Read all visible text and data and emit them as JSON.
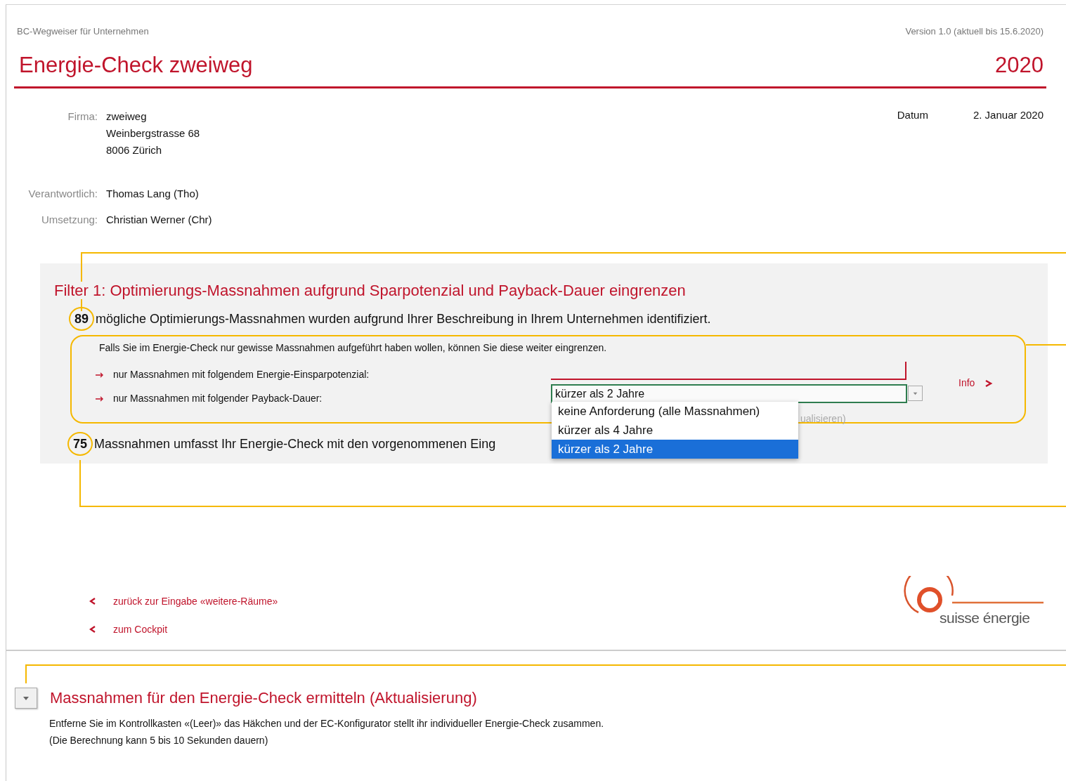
{
  "header": {
    "app_name": "BC-Wegweiser für Unternehmen",
    "version": "Version 1.0 (aktuell bis 15.6.2020)",
    "title": "Energie-Check zweiweg",
    "year": "2020"
  },
  "company": {
    "label": "Firma:",
    "lines": [
      "zweiweg",
      "Weinbergstrasse 68",
      "8006 Zürich"
    ]
  },
  "date": {
    "label": "Datum",
    "value": "2. Januar 2020"
  },
  "people": [
    {
      "label": "Verantwortlich:",
      "value": "Thomas Lang (Tho)"
    },
    {
      "label": "Umsetzung:",
      "value": "Christian Werner (Chr)"
    }
  ],
  "filter": {
    "title": "Filter 1: Optimierungs-Massnahmen aufgrund Sparpotenzial und Payback-Dauer eingrenzen",
    "identified": {
      "count": "89",
      "text": "mögliche Optimierungs-Massnahmen wurden aufgrund Ihrer Beschreibung in Ihrem Unternehmen identifiziert."
    },
    "intro": "Falls Sie im Energie-Check nur gewisse Massnahmen aufgeführt haben wollen, können Sie diese weiter eingrenzen.",
    "criteria": [
      {
        "label": "nur Massnahmen mit folgendem Energie-Einsparpotenzial:"
      },
      {
        "label": "nur Massnahmen mit folgender Payback-Dauer:",
        "value": "kürzer als 2 Jahre",
        "focused": true
      }
    ],
    "info_link": "Info",
    "dropdown": {
      "options": [
        {
          "label": "keine Anforderung (alle Massnahmen)",
          "selected": false
        },
        {
          "label": "kürzer als 4 Jahre",
          "selected": false
        },
        {
          "label": "kürzer als 2 Jahre",
          "selected": true
        }
      ]
    },
    "hint": "ualisieren)",
    "result": {
      "count": "75",
      "text": "Massnahmen umfasst Ihr Energie-Check mit den vorgenommenen Eing"
    }
  },
  "links": [
    "zurück zur Eingabe «weitere-Räume»",
    "zum Cockpit"
  ],
  "logo": {
    "text": "suisse énergie"
  },
  "update_section": {
    "title": "Massnahmen für den Energie-Check ermitteln (Aktualisierung)",
    "lines": [
      "Entferne Sie im Kontrollkasten «(Leer)» das Häkchen und der EC-Konfigurator stellt ihr individueller Energie-Check zusammen.",
      "(Die Berechnung kann 5 bis 10 Sekunden dauern)"
    ]
  }
}
